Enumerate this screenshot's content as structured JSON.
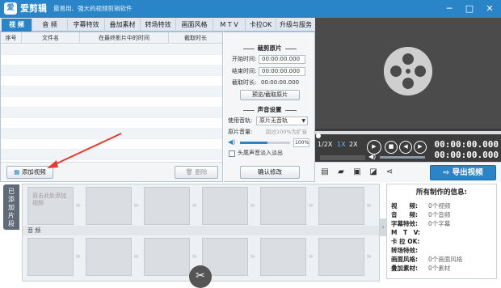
{
  "titlebar": {
    "logo": "爱",
    "app_name": "爱剪辑",
    "slogan": "最易用、强大的视频剪辑软件",
    "min": "─",
    "max": "□",
    "close": "✕"
  },
  "tabs": [
    {
      "label": "视 频",
      "active": true
    },
    {
      "label": "音 频"
    },
    {
      "label": "字幕特效"
    },
    {
      "label": "叠加素材"
    },
    {
      "label": "转场特效"
    },
    {
      "label": "画面风格"
    },
    {
      "label": "M T V"
    },
    {
      "label": "卡拉OK"
    },
    {
      "label": "升级与服务"
    }
  ],
  "clip_table": {
    "headers": [
      "序号",
      "文件名",
      "在最终影片中的时间",
      "截取时长"
    ],
    "add_button": "添加视频",
    "delete_button": "删除"
  },
  "trim": {
    "title": "裁剪原片",
    "start_label": "开始时间:",
    "start_value": "00:00:00.000",
    "end_label": "结束时间:",
    "end_value": "00:00:00.000",
    "duration_label": "截取时长:",
    "duration_value": "00:00:00.000",
    "preview_button": "预览/截取原片"
  },
  "audio": {
    "title": "声音设置",
    "track_label": "使用音轨:",
    "track_value": "原片无音轨",
    "volume_label": "原片音量:",
    "volume_hint": "超过100%为扩音",
    "volume_value": "100%",
    "volume_level": 0.55,
    "fade_label": "头尾声音淡入淡出",
    "confirm_button": "确认修改"
  },
  "player": {
    "speed_half": "1/2X",
    "speed_normal": "1X",
    "speed_double": "2X",
    "time_current": "00:00:00.000",
    "time_total": "00:00:00.000",
    "export_button": "导出视频",
    "accent": "#2a84c8"
  },
  "timeline": {
    "side_tab": "已添加片段",
    "placeholder": "双击此处添加视频",
    "audio_label": "音 频"
  },
  "info": {
    "title": "所有制作的信息:",
    "rows": [
      {
        "label": "视　　频:",
        "value": "0个视频"
      },
      {
        "label": "音　　频:",
        "value": "0个音频"
      },
      {
        "label": "字幕特效:",
        "value": "0个字幕"
      },
      {
        "label": "M　T　V:",
        "value": ""
      },
      {
        "label": "卡 拉 OK:",
        "value": ""
      },
      {
        "label": "转场特效:",
        "value": ""
      },
      {
        "label": "画面风格:",
        "value": "0个画面风格"
      },
      {
        "label": "叠加素材:",
        "value": "0个素材"
      }
    ]
  }
}
